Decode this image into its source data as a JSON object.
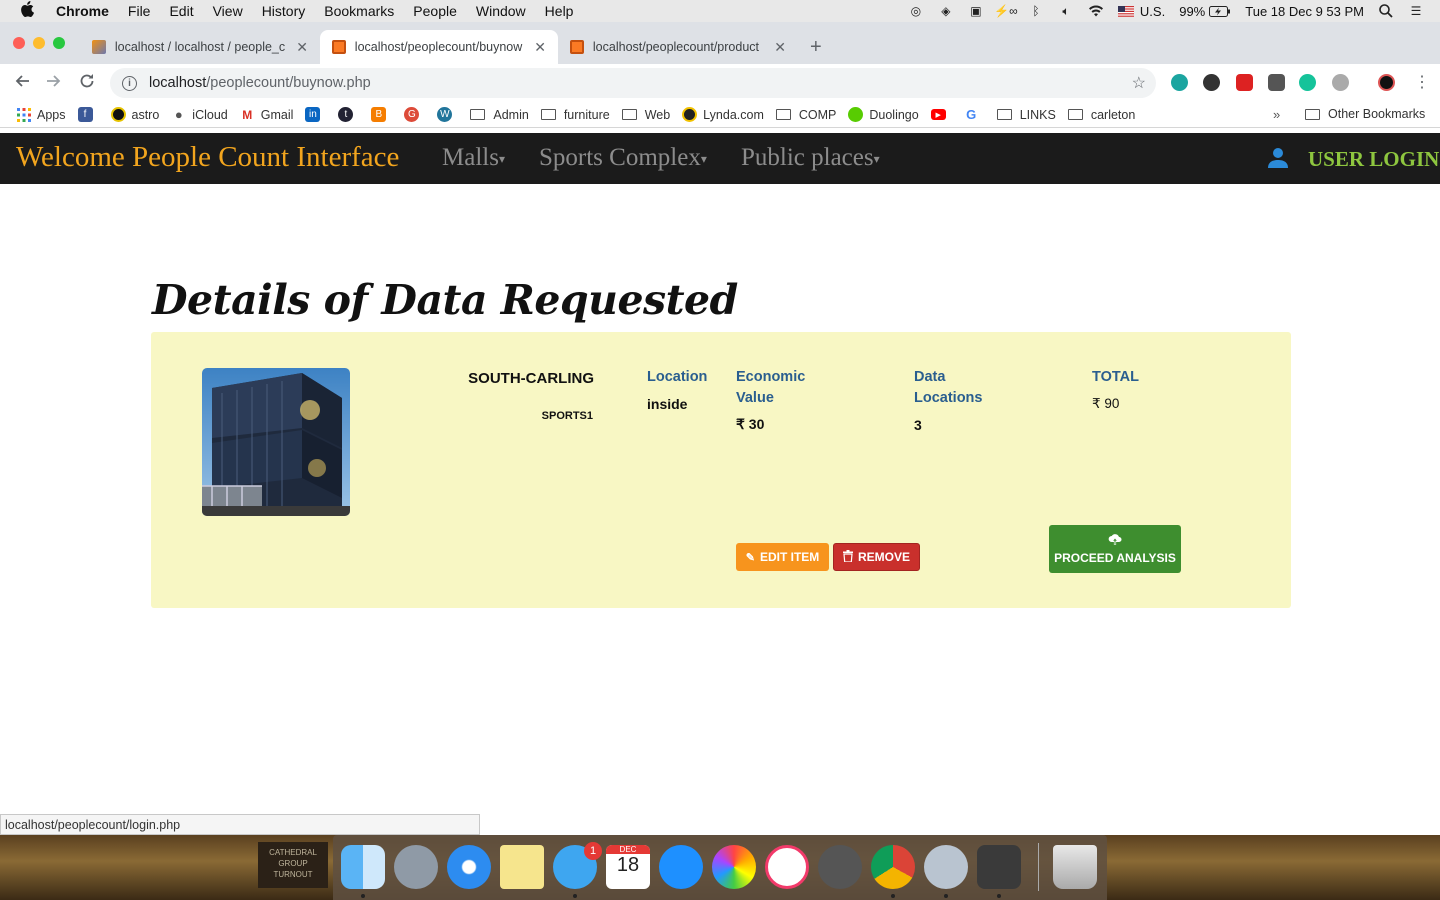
{
  "menubar": {
    "app": "Chrome",
    "items": [
      "File",
      "Edit",
      "View",
      "History",
      "Bookmarks",
      "People",
      "Window",
      "Help"
    ],
    "input_source": "U.S.",
    "battery": "99%",
    "clock": "Tue 18 Dec  9 53 PM"
  },
  "tabs": [
    {
      "title": "localhost / localhost / people_c",
      "active": false
    },
    {
      "title": "localhost/peoplecount/buynow",
      "active": true
    },
    {
      "title": "localhost/peoplecount/product",
      "active": false
    }
  ],
  "address": {
    "host": "localhost",
    "path": "/peoplecount/buynow.php"
  },
  "bookmarks": [
    "Apps",
    "astro",
    "iCloud",
    "Gmail",
    "Admin",
    "furniture",
    "Web",
    "Lynda.com",
    "COMP",
    "Duolingo",
    "LINKS",
    "carleton"
  ],
  "bookmarks_overflow": "»",
  "other_bookmarks": "Other Bookmarks",
  "site": {
    "brand": "Welcome People Count Interface",
    "nav": [
      "Malls",
      "Sports Complex",
      "Public places"
    ],
    "login": "USER LOGIN"
  },
  "page_title": "Details of Data Requested",
  "item": {
    "name": "SOUTH-CARLING",
    "code": "SPORTS1",
    "location_label": "Location",
    "location_value": "inside",
    "econ_label_1": "Economic",
    "econ_label_2": "Value",
    "econ_value": "₹ 30",
    "data_label_1": "Data",
    "data_label_2": "Locations",
    "data_value": "3",
    "total_label": "TOTAL",
    "total_value": "₹ 90"
  },
  "buttons": {
    "edit": "EDIT ITEM",
    "remove": "REMOVE",
    "proceed": "PROCEED ANALYSIS"
  },
  "status_url": "localhost/peoplecount/login.php",
  "dock_badge": "1",
  "calendar": {
    "month": "DEC",
    "day": "18"
  },
  "desktop_sign": [
    "CATHEDRAL",
    "GROUP",
    "TURNOUT"
  ]
}
